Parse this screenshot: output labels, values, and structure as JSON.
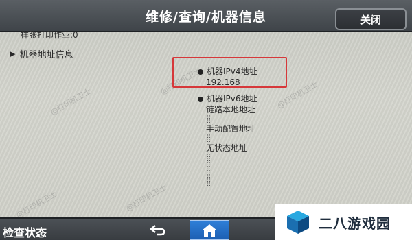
{
  "header": {
    "title": "维修/查询/机器信息",
    "close_label": "关闭"
  },
  "content": {
    "faded_line": "样张打印作业:0",
    "tree_item_label": "机器地址信息",
    "ipv4": {
      "label": "机器IPv4地址",
      "value": "192.168"
    },
    "ipv6": {
      "label": "机器IPv6地址",
      "link_local_label": "链路本地地址",
      "manual_label": "手动配置地址",
      "stateless_label": "无状态地址"
    },
    "watermark_text": "@打印机卫士"
  },
  "footer": {
    "status_label": "检查状态",
    "back_icon": "back-arrow-icon",
    "home_icon": "home-icon"
  },
  "overlay": {
    "logo_text": "二八游戏园"
  },
  "colors": {
    "header_bg": "#4a4f54",
    "highlight_box": "#d6383a",
    "home_button": "#2470c8"
  }
}
